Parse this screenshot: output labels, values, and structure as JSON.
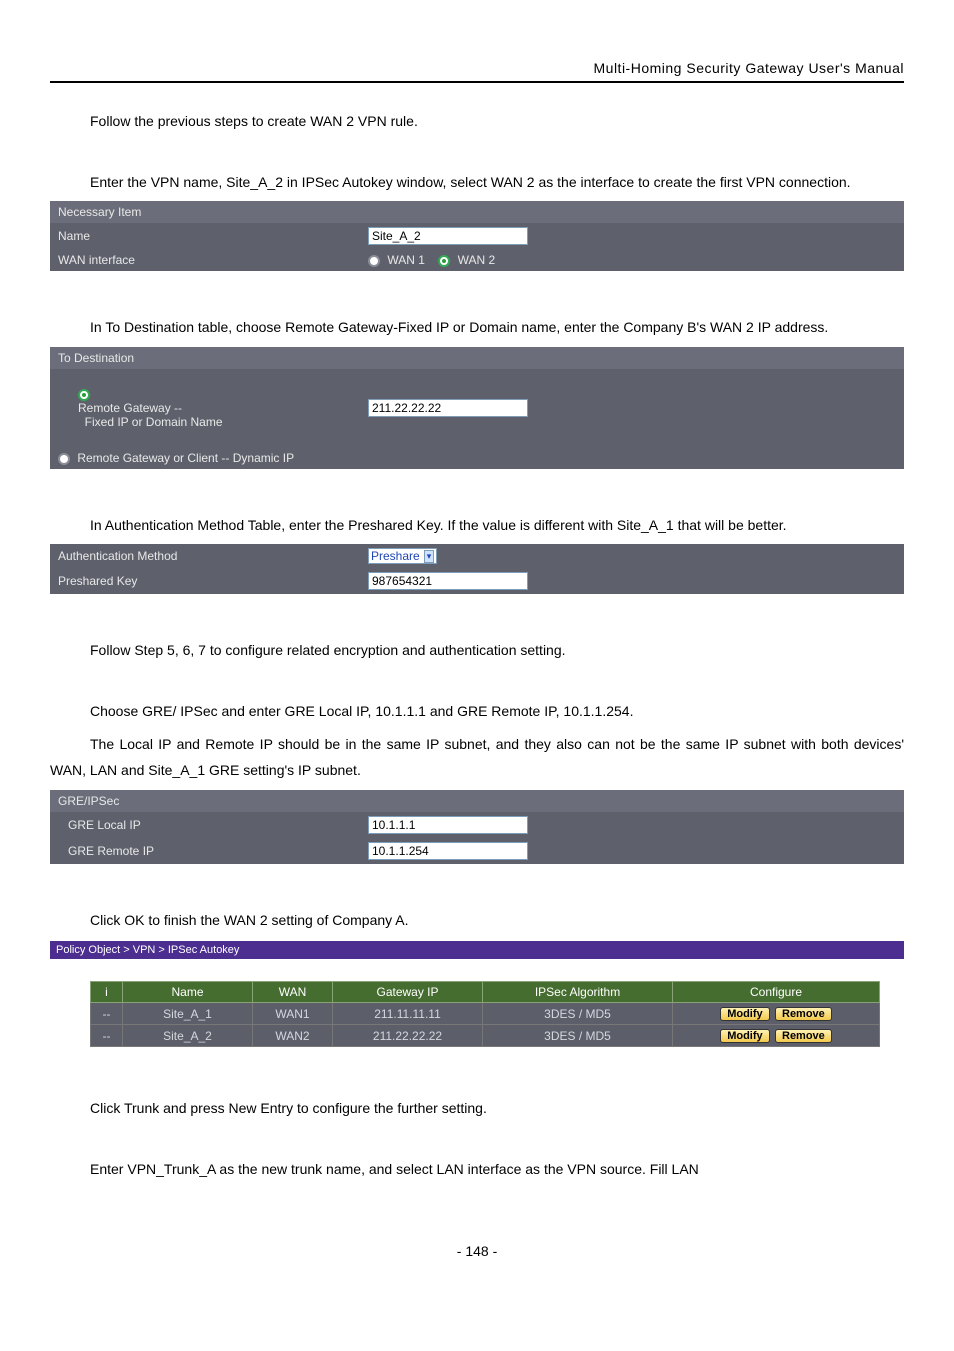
{
  "header": "Multi-Homing  Security  Gateway  User's  Manual",
  "p1": "Follow the previous steps to create WAN 2 VPN rule.",
  "p2": "Enter the VPN name, Site_A_2 in IPSec Autokey window, select WAN 2 as the interface to create the first VPN connection.",
  "necessary": {
    "title": "Necessary Item",
    "name_label": "Name",
    "name_value": "Site_A_2",
    "wan_label": "WAN interface",
    "wan1_label": "WAN 1",
    "wan2_label": "WAN 2"
  },
  "p3": "In To Destination table, choose Remote Gateway-Fixed IP or Domain name, enter the Company B's WAN 2 IP address.",
  "dest": {
    "title": "To Destination",
    "fixed_label": "Remote Gateway --\n        Fixed IP or Domain Name",
    "fixed_value": "211.22.22.22",
    "dynamic_label": "Remote Gateway or Client -- Dynamic IP"
  },
  "p4": "In Authentication Method Table, enter the Preshared Key. If the value is different with Site_A_1 that will be better.",
  "auth": {
    "method_label": "Authentication Method",
    "method_value": "Preshare",
    "psk_label": "Preshared Key",
    "psk_value": "987654321"
  },
  "p5": "Follow Step 5, 6, 7 to configure related encryption and authentication setting.",
  "p6": "Choose GRE/ IPSec and enter GRE Local IP, 10.1.1.1 and GRE Remote IP, 10.1.1.254.",
  "p7": "The Local IP and Remote IP should be in the same IP subnet, and they also can not be the same IP subnet with both devices' WAN, LAN and Site_A_1 GRE setting's IP subnet.",
  "gre": {
    "title": "GRE/IPSec",
    "local_label": "GRE Local IP",
    "local_value": "10.1.1.1",
    "remote_label": "GRE Remote IP",
    "remote_value": "10.1.1.254"
  },
  "p8": "Click OK to finish the WAN 2 setting of Company A.",
  "crumb": "Policy Object > VPN > IPSec Autokey",
  "table": {
    "headers": [
      "i",
      "Name",
      "WAN",
      "Gateway IP",
      "IPSec Algorithm",
      "Configure"
    ],
    "rows": [
      {
        "idx": "--",
        "name": "Site_A_1",
        "wan": "WAN1",
        "gw": "211.11.11.11",
        "alg": "3DES / MD5",
        "b1": "Modify",
        "b2": "Remove"
      },
      {
        "idx": "--",
        "name": "Site_A_2",
        "wan": "WAN2",
        "gw": "211.22.22.22",
        "alg": "3DES / MD5",
        "b1": "Modify",
        "b2": "Remove"
      }
    ]
  },
  "p9": "Click Trunk and press New Entry to configure the further setting.",
  "p10": "Enter VPN_Trunk_A as the new trunk name, and select LAN interface as the VPN source. Fill LAN",
  "footer": "- 148 -"
}
